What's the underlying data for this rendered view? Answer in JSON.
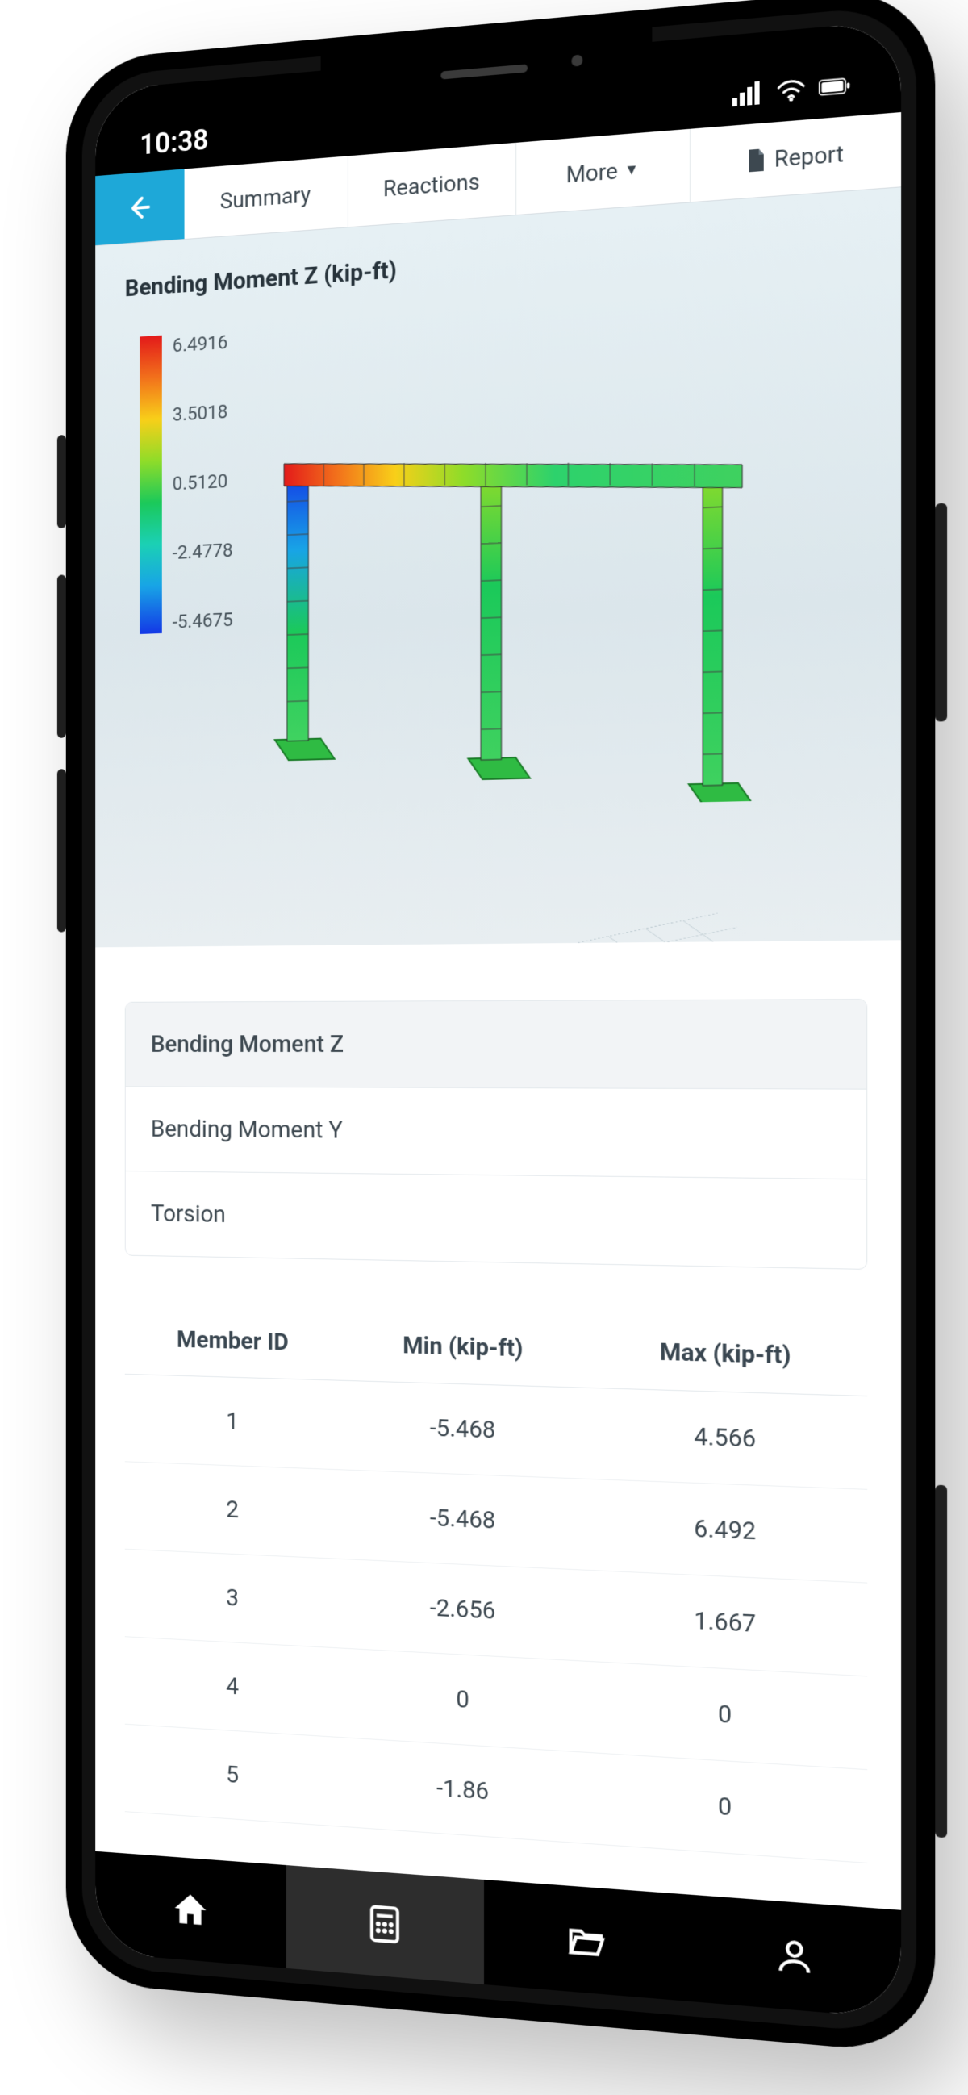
{
  "statusbar": {
    "time": "10:38"
  },
  "appbar": {
    "tabs": [
      "Summary",
      "Reactions"
    ],
    "more_label": "More",
    "report_label": "Report"
  },
  "viewport": {
    "title": "Bending Moment Z (kip-ft)",
    "legend": {
      "ticks": [
        "6.4916",
        "3.5018",
        "0.5120",
        "-2.4778",
        "-5.4675"
      ]
    }
  },
  "result_options": [
    {
      "label": "Bending Moment Z",
      "selected": true
    },
    {
      "label": "Bending Moment Y",
      "selected": false
    },
    {
      "label": "Torsion",
      "selected": false
    }
  ],
  "table": {
    "headers": {
      "id": "Member ID",
      "min": "Min (kip-ft)",
      "max": "Max (kip-ft)"
    },
    "rows": [
      {
        "id": "1",
        "min": "-5.468",
        "max": "4.566"
      },
      {
        "id": "2",
        "min": "-5.468",
        "max": "6.492"
      },
      {
        "id": "3",
        "min": "-2.656",
        "max": "1.667"
      },
      {
        "id": "4",
        "min": "0",
        "max": "0"
      },
      {
        "id": "5",
        "min": "-1.86",
        "max": "0"
      }
    ]
  },
  "chart_data": {
    "type": "table",
    "title": "Bending Moment Z (kip-ft)",
    "colorbar_label": "Bending Moment Z (kip-ft)",
    "colorbar_range": [
      -5.4675,
      6.4916
    ],
    "colorbar_ticks": [
      6.4916,
      3.5018,
      0.512,
      -2.4778,
      -5.4675
    ],
    "columns": [
      "Member ID",
      "Min (kip-ft)",
      "Max (kip-ft)"
    ],
    "rows": [
      [
        1,
        -5.468,
        4.566
      ],
      [
        2,
        -5.468,
        6.492
      ],
      [
        3,
        -2.656,
        1.667
      ],
      [
        4,
        0,
        0
      ],
      [
        5,
        -1.86,
        0
      ]
    ]
  }
}
